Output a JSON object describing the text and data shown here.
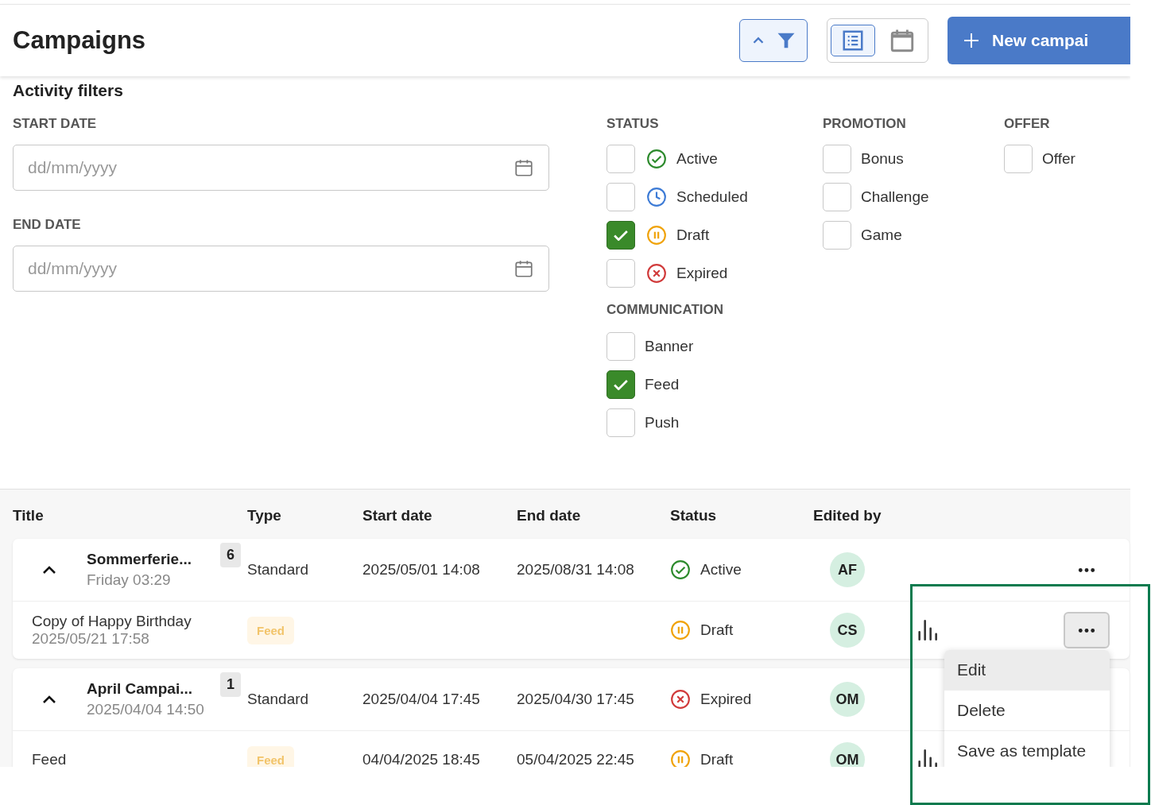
{
  "header": {
    "title": "Campaigns",
    "filter_toggle": {
      "expanded": true
    },
    "view_options": [
      {
        "kind": "list",
        "selected": true
      },
      {
        "kind": "calendar",
        "selected": false
      }
    ],
    "new_button": "New campai"
  },
  "filters": {
    "title": "Activity filters",
    "date_fields": [
      {
        "label": "START DATE",
        "placeholder": "dd/mm/yyyy"
      },
      {
        "label": "END DATE",
        "placeholder": "dd/mm/yyyy"
      }
    ],
    "columns": [
      [
        {
          "label": "STATUS",
          "options": [
            {
              "label": "Active",
              "kind": "active",
              "checked": false
            },
            {
              "label": "Scheduled",
              "kind": "scheduled",
              "checked": false
            },
            {
              "label": "Draft",
              "kind": "draft",
              "checked": true
            },
            {
              "label": "Expired",
              "kind": "expired",
              "checked": false
            }
          ]
        },
        {
          "label": "COMMUNICATION",
          "options": [
            {
              "label": "Banner",
              "checked": false
            },
            {
              "label": "Feed",
              "checked": true
            },
            {
              "label": "Push",
              "checked": false
            }
          ]
        }
      ],
      [
        {
          "label": "PROMOTION",
          "options": [
            {
              "label": "Bonus",
              "checked": false
            },
            {
              "label": "Challenge",
              "checked": false
            },
            {
              "label": "Game",
              "checked": false
            }
          ]
        }
      ],
      [
        {
          "label": "OFFER",
          "options": [
            {
              "label": "Offer",
              "checked": false
            }
          ]
        }
      ]
    ]
  },
  "table": {
    "columns": [
      "Title",
      "Type",
      "Start date",
      "End date",
      "Status",
      "Edited by"
    ],
    "groups": [
      {
        "expanded": true,
        "title": "Sommerferie...",
        "subtitle": "Friday 03:29",
        "count": "6",
        "type": "Standard",
        "start": "2025/05/01 14:08",
        "end": "2025/08/31 14:08",
        "status": {
          "kind": "active",
          "label": "Active"
        },
        "editor": "AF",
        "actions": [
          {
            "kind": "more",
            "open": false
          }
        ],
        "children": [
          {
            "title": "Copy of Happy Birthday",
            "subtitle": "2025/05/21 17:58",
            "tag": "Feed",
            "status": {
              "kind": "draft",
              "label": "Draft"
            },
            "editor": "CS",
            "actions": [
              {
                "kind": "stats"
              },
              {
                "kind": "more",
                "open": true
              }
            ]
          }
        ]
      },
      {
        "expanded": true,
        "title": "April Campai...",
        "subtitle": "2025/04/04 14:50",
        "count": "1",
        "type": "Standard",
        "start": "2025/04/04 17:45",
        "end": "2025/04/30 17:45",
        "status": {
          "kind": "expired",
          "label": "Expired"
        },
        "editor": "OM",
        "children": [
          {
            "title": "Feed",
            "tag": "Feed",
            "start": "04/04/2025 18:45",
            "end": "05/04/2025 22:45",
            "status": {
              "kind": "draft",
              "label": "Draft"
            },
            "editor": "OM",
            "actions": [
              {
                "kind": "stats"
              }
            ]
          }
        ]
      }
    ]
  },
  "menu": {
    "items": [
      {
        "label": "Edit",
        "highlighted": true
      },
      {
        "label": "Delete",
        "highlighted": false
      },
      {
        "label": "Save as template",
        "highlighted": false
      }
    ]
  },
  "annotation": {
    "kind": "frame"
  }
}
